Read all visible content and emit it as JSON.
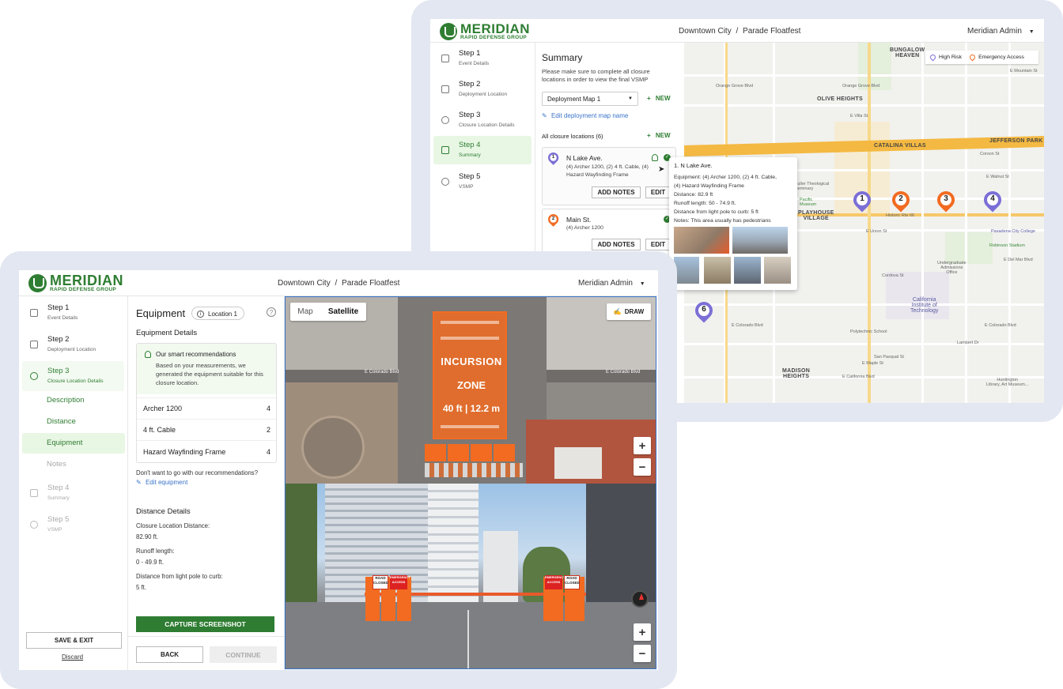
{
  "back": {
    "logo": {
      "main": "MERIDIAN",
      "sub": "RAPID DEFENSE GROUP"
    },
    "breadcrumb": {
      "city": "Downtown City",
      "sep": "/",
      "event": "Parade Floatfest"
    },
    "user": "Meridian Admin",
    "steps": [
      {
        "title": "Step 1",
        "sub": "Event Details"
      },
      {
        "title": "Step 2",
        "sub": "Deployment Location"
      },
      {
        "title": "Step 3",
        "sub": "Closure Location Details"
      },
      {
        "title": "Step 4",
        "sub": "Summary"
      },
      {
        "title": "Step 5",
        "sub": "VSMP"
      }
    ],
    "summary": {
      "title": "Summary",
      "desc": "Please make sure to complete all closure locations in order to view the final VSMP",
      "map_select": "Deployment Map 1",
      "new_label": "NEW",
      "edit_map_name": "Edit deployment map name",
      "all_locations": "All closure locations (6)",
      "locations": [
        {
          "num": "1",
          "name": "N Lake Ave.",
          "desc": "(4) Archer 1200, (2) 4 ft. Cable, (4) Hazard Wayfinding Frame",
          "add_notes": "ADD NOTES",
          "edit": "EDIT"
        },
        {
          "num": "2",
          "name": "Main St.",
          "desc": "(4) Archer 1200",
          "add_notes": "ADD NOTES",
          "edit": "EDIT"
        }
      ]
    },
    "tooltip": {
      "title": "1. N Lake Ave.",
      "lines": [
        "Equipment: (4) Archer 1200, (2) 4 ft. Cable,",
        "(4) Hazard Wayfinding Frame",
        "Distance: 82.9 ft",
        "Runoff length: 50 - 74.9 ft.",
        "Distance from light pole to curb: 5 ft",
        "Notes: This area usually has pedestrians"
      ]
    },
    "legend": {
      "high_risk": "High Risk",
      "emergency": "Emergency Access"
    },
    "map_labels": {
      "bungalow": "BUNGALOW\nHEAVEN",
      "olive": "OLIVE HEIGHTS",
      "catalina": "CATALINA VILLAS",
      "jefferson": "JEFFERSON PARK",
      "playhouse": "PLAYHOUSE\nVILLAGE",
      "madison": "MADISON\nHEIGHTS",
      "caltech": "California\nInstitute of\nTechnology",
      "pcc": "Pasadena City College",
      "robinson": "Robinson Stadium",
      "mountain": "E Mountain St",
      "orange": "Orange Grove Blvd",
      "corson": "Corson St",
      "walnut": "E Walnut St",
      "rte66": "Historic Rte 66",
      "union": "E Union St",
      "colorado": "E Colorado Blvd",
      "california": "E California Blvd",
      "delmar": "E Del Mar Blvd",
      "cordova": "Cordova St",
      "lakeave": "N Lake Ave",
      "hillave": "N Hill Ave",
      "allenave": "Allen Ave",
      "lospobles": "Los Robles Ave",
      "hotelvl": "Huntington\nLibrary, Art Museum...",
      "poly": "Polytechnic School",
      "pacific": "Pacific\nMuseum",
      "fuller": "Fuller Theological\nSeminary",
      "undergrad": "Undergraduate\nAdmissions\nOffice",
      "villa": "E Villa St",
      "maple": "E Maple St",
      "lambert": "Lambert Dr",
      "sanpasq": "San Pasqual St",
      "fairoaks": "Fair Oaks Ave"
    },
    "pins": [
      {
        "num": "1",
        "color": "#7b6fd6"
      },
      {
        "num": "2",
        "color": "#f26b21"
      },
      {
        "num": "3",
        "color": "#f26b21"
      },
      {
        "num": "4",
        "color": "#7b6fd6"
      },
      {
        "num": "6",
        "color": "#7b6fd6"
      }
    ]
  },
  "front": {
    "logo": {
      "main": "MERIDIAN",
      "sub": "RAPID DEFENSE GROUP"
    },
    "breadcrumb": {
      "city": "Downtown City",
      "sep": "/",
      "event": "Parade Floatfest"
    },
    "user": "Meridian Admin",
    "steps": [
      {
        "title": "Step 1",
        "sub": "Event Details"
      },
      {
        "title": "Step 2",
        "sub": "Deployment Location"
      },
      {
        "title": "Step 3",
        "sub": "Closure Location Details"
      },
      {
        "title": "Step 4",
        "sub": "Summary"
      },
      {
        "title": "Step 5",
        "sub": "VSMP"
      }
    ],
    "substeps": [
      "Description",
      "Distance",
      "Equipment",
      "Notes"
    ],
    "save_exit": "SAVE & EXIT",
    "discard": "Discard",
    "equipment": {
      "title": "Equipment",
      "location_badge": "Location 1",
      "details_heading": "Equipment Details",
      "reco_title": "Our smart recommendations",
      "reco_desc": "Based on your measurements, we generated the equipment suitable for this closure location.",
      "items": [
        {
          "name": "Archer 1200",
          "qty": "4"
        },
        {
          "name": "4 ft. Cable",
          "qty": "2"
        },
        {
          "name": "Hazard Wayfinding Frame",
          "qty": "4"
        }
      ],
      "not_go": "Don't want to go with our recommendations?",
      "edit_equipment": "Edit equipment",
      "distance_heading": "Distance Details",
      "closure_label": "Closure Location Distance:",
      "closure_value": "82.90 ft.",
      "runoff_label": "Runoff length:",
      "runoff_value": "0 - 49.9 ft.",
      "pole_label": "Distance from light pole to curb:",
      "pole_value": "5 ft.",
      "capture": "CAPTURE SCREENSHOT",
      "back": "BACK",
      "continue": "CONTINUE"
    },
    "map": {
      "tab_map": "Map",
      "tab_satellite": "Satellite",
      "draw": "DRAW",
      "zone_line1": "INCURSION",
      "zone_line2": "ZONE",
      "zone_measure": "40 ft | 12.2 m",
      "street_label": "E Colorado Blvd",
      "sign_road_closed": "ROAD\nCLOSED",
      "sign_emergency": "EMERGENCY\nACCESS"
    },
    "colors": {
      "brand": "#2e7d32",
      "zone": "#f26b21",
      "active_bg": "#e8f6e4"
    }
  }
}
